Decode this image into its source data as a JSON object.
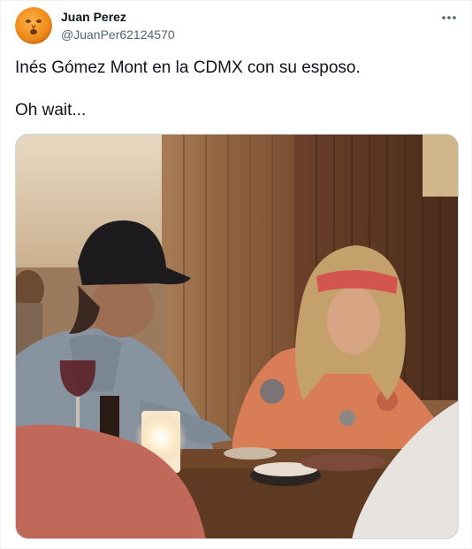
{
  "tweet": {
    "author": {
      "display_name": "Juan Perez",
      "handle": "@JuanPer62124570",
      "avatar_icon": "orange-face-avatar"
    },
    "more_icon": "more-options-icon",
    "text_lines": [
      "Inés Gómez Mont en la CDMX con su esposo.",
      "Oh wait..."
    ],
    "media": {
      "type": "photo",
      "subject": "restaurant-photo"
    }
  },
  "colors": {
    "name": "#0f1419",
    "handle": "#536471",
    "border": "#eff3f4",
    "avatar": "#f08a1c"
  }
}
